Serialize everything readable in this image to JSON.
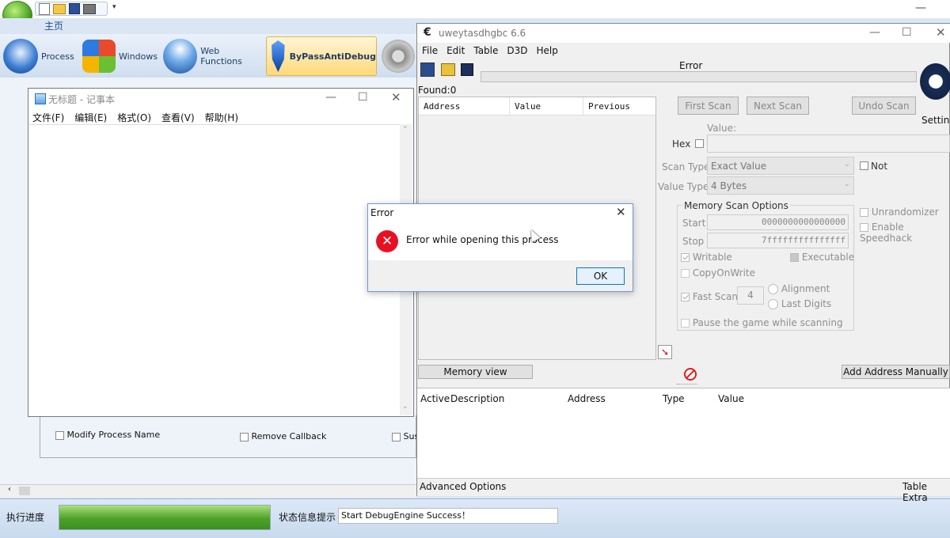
{
  "host_app": {
    "home_tab": "主页",
    "nav": [
      {
        "label": "Process",
        "icon": "process-icon"
      },
      {
        "label": "Windows",
        "icon": "windows-icon"
      },
      {
        "label": "Web Functions",
        "icon": "web-functions-icon"
      },
      {
        "label": "ByPassAntiDebug",
        "icon": "shield-icon"
      }
    ],
    "options": [
      "Modify Process Name",
      "Remove Callback",
      "Sus"
    ],
    "status_label": "执行进度",
    "status_info_label": "状态信息提示",
    "status_info_value": "Start DebugEngine Success！"
  },
  "notepad": {
    "title": "无标题 - 记事本",
    "menu": [
      "文件(F)",
      "编辑(E)",
      "格式(O)",
      "查看(V)",
      "帮助(H)"
    ]
  },
  "ce": {
    "title": "uweytasdhgbc 6.6",
    "menu": [
      "File",
      "Edit",
      "Table",
      "D3D",
      "Help"
    ],
    "status_title": "Error",
    "found": "Found:0",
    "columns": [
      "Address",
      "Value",
      "Previous"
    ],
    "buttons": {
      "first_scan": "First Scan",
      "next_scan": "Next Scan",
      "undo_scan": "Undo Scan",
      "memory_view": "Memory view",
      "add_address": "Add Address Manually"
    },
    "settings_label": "Setting",
    "value_label": "Value:",
    "hex_label": "Hex",
    "scan_type_label": "Scan Type",
    "scan_type_value": "Exact Value",
    "value_type_label": "Value Type",
    "value_type_value": "4 Bytes",
    "not_label": "Not",
    "memory_scan_options": "Memory Scan Options",
    "start_label": "Start",
    "start_value": "0000000000000000",
    "stop_label": "Stop",
    "stop_value": "7fffffffffffffff",
    "writable": "Writable",
    "executable": "Executable",
    "copyonwrite": "CopyOnWrite",
    "fast_scan": "Fast Scan",
    "fast_scan_value": "4",
    "alignment": "Alignment",
    "last_digits": "Last Digits",
    "pause_game": "Pause the game while scanning",
    "unrandomizer": "Unrandomizer",
    "speedhack": "Enable Speedhack",
    "table_columns": [
      "Active",
      "Description",
      "Address",
      "Type",
      "Value"
    ],
    "advanced_options": "Advanced Options",
    "table_extras": "Table Extra"
  },
  "error_dialog": {
    "title": "Error",
    "message": "Error while opening this process",
    "ok": "OK"
  }
}
